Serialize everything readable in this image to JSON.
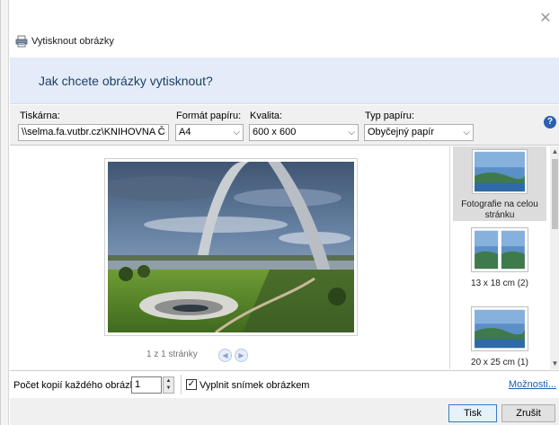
{
  "window": {
    "close_glyph": "✕",
    "title": "Vytisknout obrázky",
    "title_icon": "printer-icon"
  },
  "banner": {
    "heading": "Jak chcete obrázky vytisknout?"
  },
  "toolbar": {
    "printer_label": "Tiskárna:",
    "printer_value": "\\\\selma.fa.vutbr.cz\\KNIHOVNA Č",
    "paper_size_label": "Formát papíru:",
    "paper_size_value": "A4",
    "quality_label": "Kvalita:",
    "quality_value": "600 x 600",
    "paper_type_label": "Typ papíru:",
    "paper_type_value": "Obyčejný papír",
    "help_glyph": "?"
  },
  "preview": {
    "page_status": "1 z 1 stránky",
    "prev_glyph": "◀",
    "next_glyph": "▶"
  },
  "layouts": [
    {
      "label": "Fotografie na celou stránku",
      "selected": true
    },
    {
      "label": "13 x 18 cm (2)",
      "selected": false
    },
    {
      "label": "20 x 25 cm (1)",
      "selected": false
    }
  ],
  "options_row": {
    "copies_label": "Počet kopií každého obrázku:",
    "copies_value": "1",
    "fill_label": "Vyplnit snímek obrázkem",
    "fill_checked": true,
    "options_link": "Možnosti..."
  },
  "buttons": {
    "print": "Tisk",
    "cancel": "Zrušit"
  },
  "colors": {
    "banner_bg": "#e3ecf8",
    "banner_text": "#1e3f66",
    "link": "#1a5fb4",
    "primary_border": "#3b78c8"
  }
}
